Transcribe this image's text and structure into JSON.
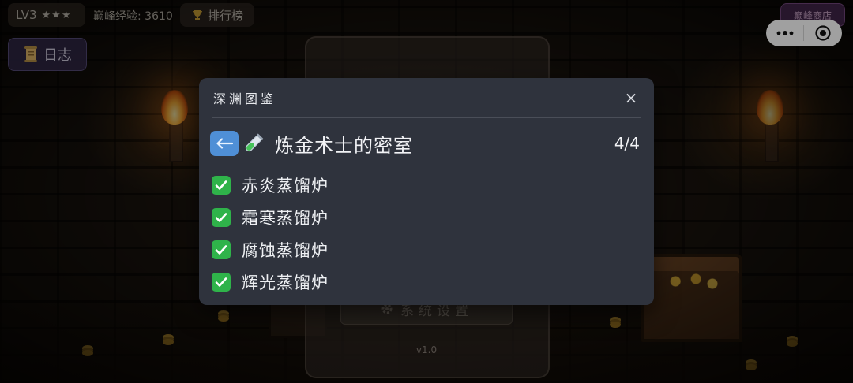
{
  "hud": {
    "level_label": "LV3",
    "stars": "★★★",
    "peak_exp": "巅峰经验: 3610",
    "rank_button": "排行榜",
    "shop_button": "巅峰商店",
    "log_button": "日志"
  },
  "background_menu": {
    "settings_button": "系统设置",
    "version": "v1.0"
  },
  "modal": {
    "title": "深渊图鉴",
    "close_label": "×",
    "room_name": "炼金术士的密室",
    "progress": "4/4",
    "items": [
      {
        "label": "赤炎蒸馏炉",
        "checked": true
      },
      {
        "label": "霜寒蒸馏炉",
        "checked": true
      },
      {
        "label": "腐蚀蒸馏炉",
        "checked": true
      },
      {
        "label": "辉光蒸馏炉",
        "checked": true
      }
    ]
  },
  "colors": {
    "modal_bg": "#2f333d",
    "back_button": "#4f8fd6",
    "check_green": "#2fb34a"
  },
  "icons": {
    "back": "left-arrow-icon",
    "room": "test-tube-icon",
    "check": "check-icon",
    "close": "close-icon",
    "more": "more-dots-icon",
    "target": "target-icon",
    "trophy": "trophy-icon",
    "scroll": "scroll-icon",
    "gear": "gear-icon"
  }
}
